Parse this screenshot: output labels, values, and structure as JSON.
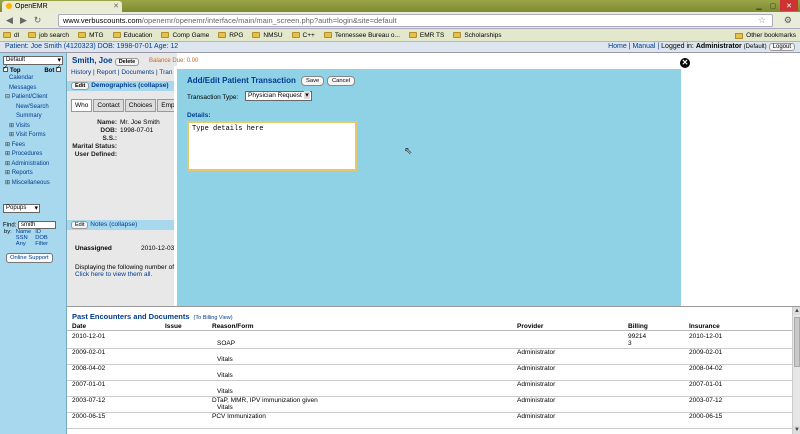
{
  "browser": {
    "tab_title": "OpenEMR",
    "url_domain": "www.verbuscounts.com",
    "url_rest": "/openemr/openemr/interface/main/main_screen.php?auth=login&site=default",
    "bookmarks": [
      "dl",
      "job search",
      "MTG",
      "Education",
      "Comp Game",
      "RPG",
      "NMSU",
      "C++",
      "Tennessee Bureau o...",
      "EMR TS",
      "Scholarships"
    ],
    "other_bookmarks": "Other bookmarks"
  },
  "header": {
    "patient_info": "Patient: Joe Smith (4120323)  DOB: 1998-07-01 Age: 12",
    "home": "Home",
    "manual": "Manual",
    "logged_in": "Logged in:",
    "user": "Administrator",
    "site": "(Default)",
    "logout": "Logout"
  },
  "leftnav": {
    "default_select": "Default",
    "top_label": "Top",
    "bot_label": "Bot",
    "items": [
      {
        "label": "Calendar",
        "level": 1
      },
      {
        "label": "Messages",
        "level": 1
      },
      {
        "label": "Patient/Client",
        "level": 0
      },
      {
        "label": "New/Search",
        "level": 2
      },
      {
        "label": "Summary",
        "level": 2
      },
      {
        "label": "Visits",
        "level": 1
      },
      {
        "label": "Visit Forms",
        "level": 1
      },
      {
        "label": "Fees",
        "level": 0
      },
      {
        "label": "Procedures",
        "level": 0
      },
      {
        "label": "Administration",
        "level": 0
      },
      {
        "label": "Reports",
        "level": 0
      },
      {
        "label": "Miscellaneous",
        "level": 0
      }
    ],
    "popups": "Popups",
    "find_label": "Find:",
    "find_value": "smith",
    "by_label": "by:",
    "by_name": "Name",
    "by_id": "ID",
    "by_ssn": "SSN",
    "by_dob": "DOB",
    "by_any": "Any",
    "by_filter": "Filter",
    "support": "Online Support"
  },
  "patient": {
    "name": "Smith, Joe",
    "delete": "Delete",
    "balance": "Balance Due: 0.00",
    "subnav": "History | Report | Documents | Tran",
    "edit": "Edit",
    "demographics": "Demographics (collapse)",
    "tabs": [
      "Who",
      "Contact",
      "Choices",
      "Employ"
    ],
    "fields": [
      {
        "label": "Name:",
        "value": "Mr. Joe  Smith"
      },
      {
        "label": "DOB:",
        "value": "1998-07-01"
      },
      {
        "label": "S.S.:",
        "value": ""
      },
      {
        "label": "Marital Status:",
        "value": ""
      },
      {
        "label": "User Defined:",
        "value": ""
      }
    ],
    "notes": "Notes (collapse)",
    "unassigned": "Unassigned",
    "unassigned_date": "2010-12-03",
    "display_text": "Displaying the following number of",
    "click_here": "Click here to view them all."
  },
  "modal": {
    "title": "Add/Edit Patient Transaction",
    "save": "Save",
    "cancel": "Cancel",
    "transaction_type_label": "Transaction Type:",
    "transaction_type_value": "Physician Request",
    "details_label": "Details:",
    "details_placeholder": "Type details here"
  },
  "encounters": {
    "title": "Past Encounters and Documents",
    "billing_link": "(To Billing View)",
    "headers": {
      "date": "Date",
      "issue": "Issue",
      "reason": "Reason/Form",
      "provider": "Provider",
      "billing": "Billing",
      "insurance": "Insurance"
    },
    "rows": [
      {
        "date": "2010-12-01",
        "reason": "",
        "form": "SOAP",
        "provider": "",
        "billing": "99214",
        "billing2": "3",
        "insurance": "2010-12-01"
      },
      {
        "date": "2009-02-01",
        "reason": "",
        "form": "Vitals",
        "provider": "Administrator",
        "billing": "",
        "billing2": "",
        "insurance": "2009-02-01"
      },
      {
        "date": "2008-04-02",
        "reason": "",
        "form": "Vitals",
        "provider": "Administrator",
        "billing": "",
        "billing2": "",
        "insurance": "2008-04-02"
      },
      {
        "date": "2007-01-01",
        "reason": "",
        "form": "Vitals",
        "provider": "Administrator",
        "billing": "",
        "billing2": "",
        "insurance": "2007-01-01"
      },
      {
        "date": "2003-07-12",
        "reason": "DTaP, MMR, IPV immunization given",
        "form": "Vitals",
        "provider": "Administrator",
        "billing": "",
        "billing2": "",
        "insurance": "2003-07-12"
      },
      {
        "date": "2000-06-15",
        "reason": "PCV Immunization",
        "form": "",
        "provider": "Administrator",
        "billing": "",
        "billing2": "",
        "insurance": "2000-06-15"
      }
    ]
  }
}
